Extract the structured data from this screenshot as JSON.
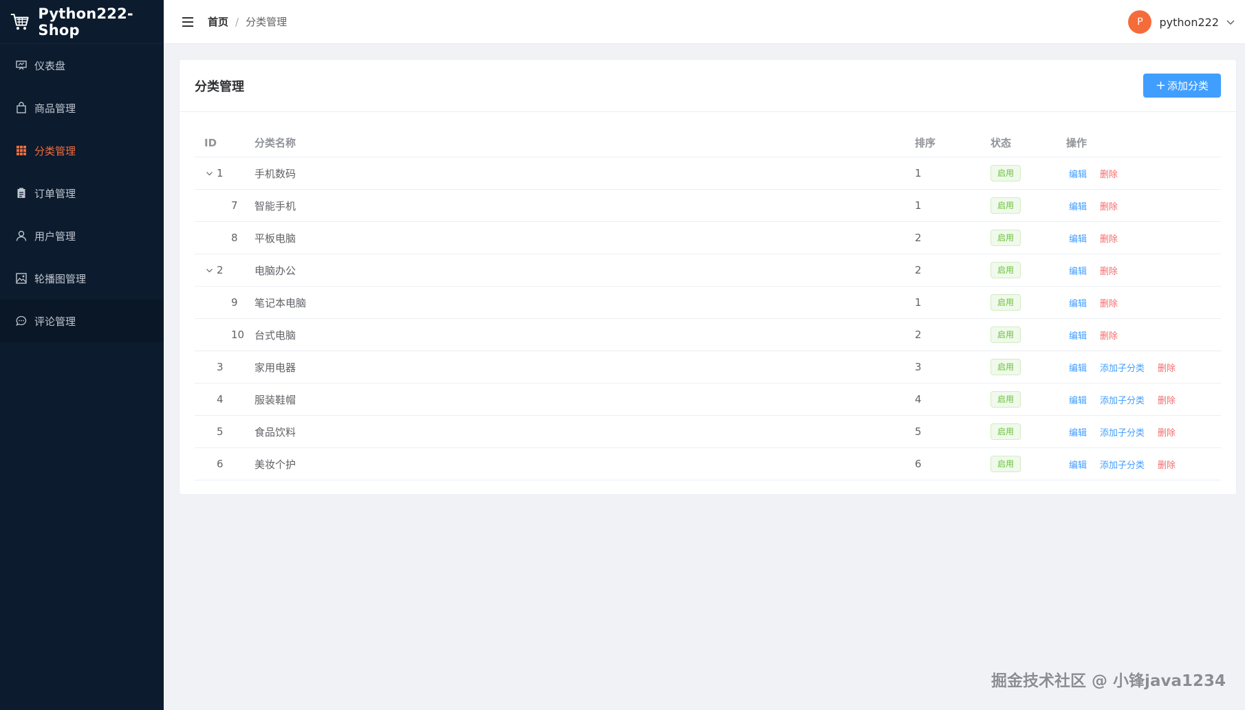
{
  "app": {
    "title": "Python222-Shop"
  },
  "sidebar": {
    "items": [
      {
        "label": "仪表盘",
        "icon": "dashboard-icon",
        "active": false
      },
      {
        "label": "商品管理",
        "icon": "shopping-bag-icon",
        "active": false
      },
      {
        "label": "分类管理",
        "icon": "grid-icon",
        "active": true
      },
      {
        "label": "订单管理",
        "icon": "clipboard-icon",
        "active": false
      },
      {
        "label": "用户管理",
        "icon": "user-icon",
        "active": false
      },
      {
        "label": "轮播图管理",
        "icon": "picture-icon",
        "active": false
      },
      {
        "label": "评论管理",
        "icon": "chat-bubble-icon",
        "active": false
      }
    ]
  },
  "header": {
    "breadcrumb": {
      "home": "首页",
      "separator": "/",
      "current": "分类管理"
    },
    "user": {
      "avatar_letter": "P",
      "name": "python222"
    }
  },
  "card": {
    "title": "分类管理",
    "add_button": {
      "icon": "+",
      "label": "添加分类"
    }
  },
  "table": {
    "columns": {
      "id": "ID",
      "name": "分类名称",
      "sort": "排序",
      "status": "状态",
      "ops": "操作"
    },
    "rows": [
      {
        "id": "1",
        "name": "手机数码",
        "sort": "1",
        "status": "启用",
        "level": 0,
        "expanded": true,
        "ops": [
          "编辑",
          "删除"
        ]
      },
      {
        "id": "7",
        "name": "智能手机",
        "sort": "1",
        "status": "启用",
        "level": 1,
        "ops": [
          "编辑",
          "删除"
        ]
      },
      {
        "id": "8",
        "name": "平板电脑",
        "sort": "2",
        "status": "启用",
        "level": 1,
        "ops": [
          "编辑",
          "删除"
        ]
      },
      {
        "id": "2",
        "name": "电脑办公",
        "sort": "2",
        "status": "启用",
        "level": 0,
        "expanded": true,
        "ops": [
          "编辑",
          "删除"
        ]
      },
      {
        "id": "9",
        "name": "笔记本电脑",
        "sort": "1",
        "status": "启用",
        "level": 1,
        "ops": [
          "编辑",
          "删除"
        ]
      },
      {
        "id": "10",
        "name": "台式电脑",
        "sort": "2",
        "status": "启用",
        "level": 1,
        "ops": [
          "编辑",
          "删除"
        ]
      },
      {
        "id": "3",
        "name": "家用电器",
        "sort": "3",
        "status": "启用",
        "level": 0,
        "ops": [
          "编辑",
          "添加子分类",
          "删除"
        ]
      },
      {
        "id": "4",
        "name": "服装鞋帽",
        "sort": "4",
        "status": "启用",
        "level": 0,
        "ops": [
          "编辑",
          "添加子分类",
          "删除"
        ]
      },
      {
        "id": "5",
        "name": "食品饮料",
        "sort": "5",
        "status": "启用",
        "level": 0,
        "ops": [
          "编辑",
          "添加子分类",
          "删除"
        ]
      },
      {
        "id": "6",
        "name": "美妆个护",
        "sort": "6",
        "status": "启用",
        "level": 0,
        "ops": [
          "编辑",
          "添加子分类",
          "删除"
        ]
      }
    ]
  },
  "watermark": "掘金技术社区 @ 小锋java1234",
  "colors": {
    "sidebar_bg": "#0c1b2e",
    "accent": "#f56c3a",
    "primary": "#409eff",
    "danger": "#f56c6c",
    "success": "#67c23a"
  }
}
